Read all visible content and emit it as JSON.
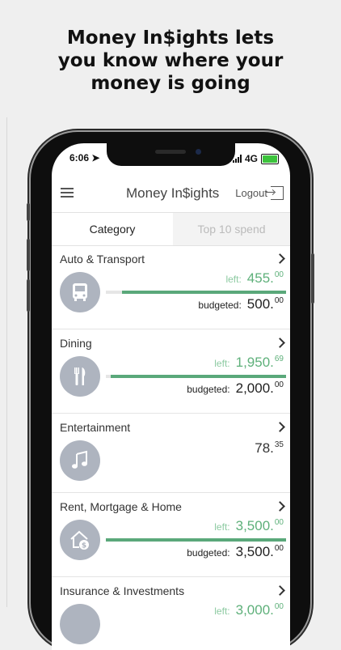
{
  "headline": {
    "line1": "Money In$ights lets",
    "line2": "you know where your",
    "line3": "money is going"
  },
  "status": {
    "time": "6:06",
    "network": "4G"
  },
  "app": {
    "title": "Money In$ights",
    "logout_label": "Logout"
  },
  "tabs": [
    {
      "label": "Category"
    },
    {
      "label": "Top 10 spend"
    }
  ],
  "labels": {
    "left": "left:",
    "budgeted": "budgeted:"
  },
  "categories": [
    {
      "name": "Auto & Transport",
      "left_int": "455.",
      "left_dec": "00",
      "budget_int": "500.",
      "budget_dec": "00",
      "remaining_fraction": 0.91,
      "icon": "bus-icon"
    },
    {
      "name": "Dining",
      "left_int": "1,950.",
      "left_dec": "69",
      "budget_int": "2,000.",
      "budget_dec": "00",
      "remaining_fraction": 0.975,
      "icon": "fork-knife-icon"
    },
    {
      "name": "Entertainment",
      "spent_int": "78.",
      "spent_dec": "35",
      "icon": "music-note-icon"
    },
    {
      "name": "Rent, Mortgage & Home",
      "left_int": "3,500.",
      "left_dec": "00",
      "budget_int": "3,500.",
      "budget_dec": "00",
      "remaining_fraction": 1.0,
      "icon": "house-dollar-icon"
    },
    {
      "name": "Insurance & Investments",
      "left_int": "3,000.",
      "left_dec": "00",
      "icon": "insurance-icon"
    }
  ],
  "colors": {
    "accent_green": "#5aa87a",
    "icon_bg": "#aeb4bf"
  }
}
